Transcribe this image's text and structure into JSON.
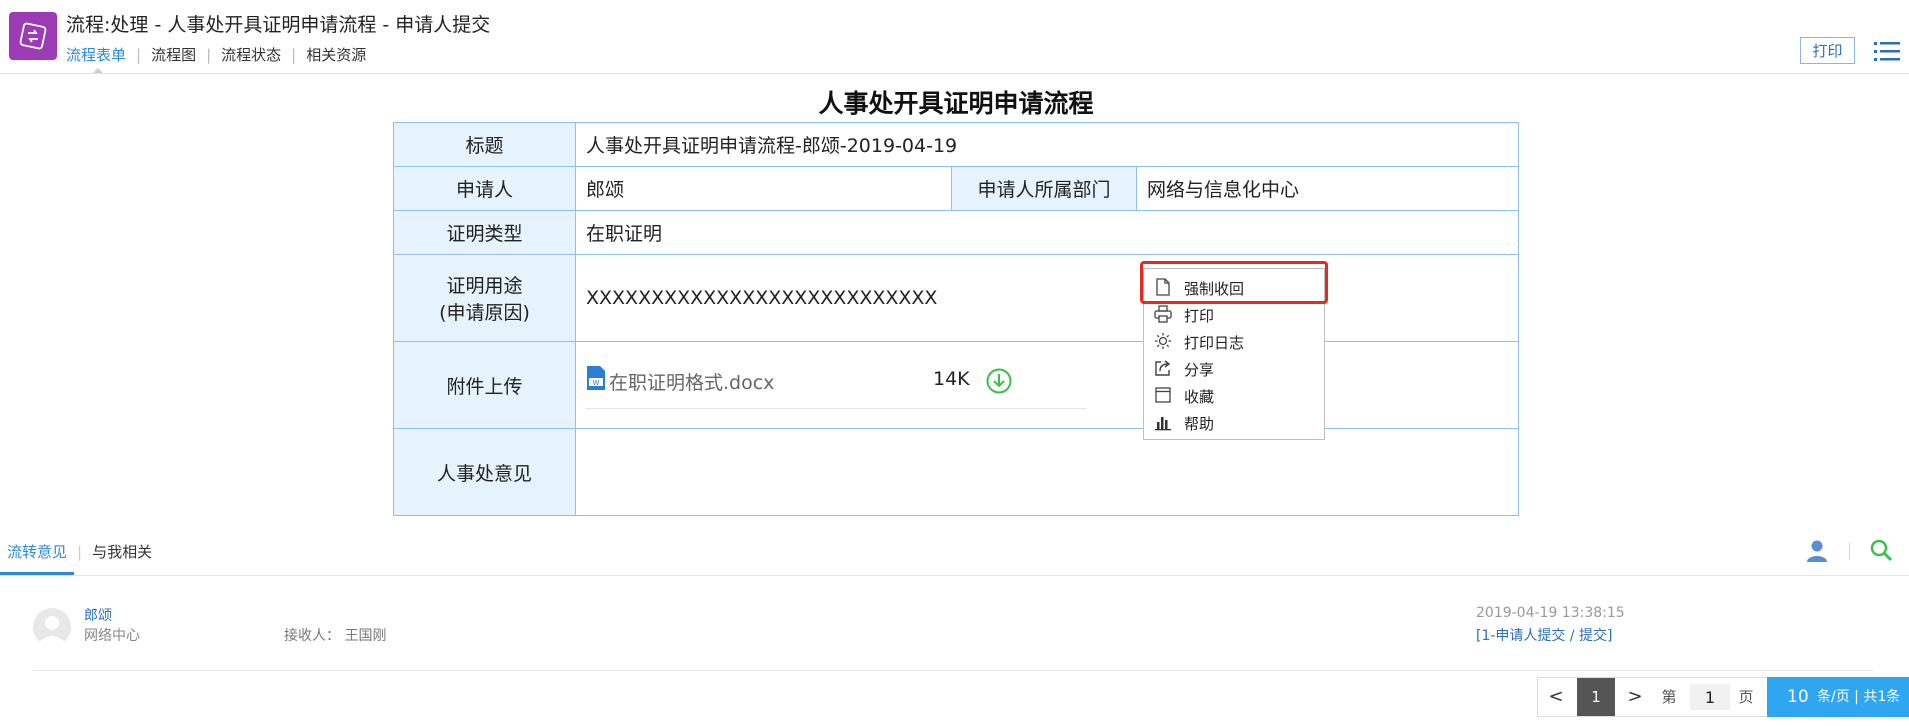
{
  "header": {
    "title": "流程:处理 - 人事处开具证明申请流程 - 申请人提交",
    "tabs": [
      "流程表单",
      "流程图",
      "流程状态",
      "相关资源"
    ],
    "print_label": "打印"
  },
  "form": {
    "title": "人事处开具证明申请流程",
    "title_label": "标题",
    "title_value": "人事处开具证明申请流程-郎颂-2019-04-19",
    "applicant_label": "申请人",
    "applicant_value": "郎颂",
    "dept_label": "申请人所属部门",
    "dept_value": "网络与信息化中心",
    "cert_type_label": "证明类型",
    "cert_type_value": "在职证明",
    "purpose_label_1": "证明用途",
    "purpose_label_2": "(申请原因)",
    "purpose_value": "XXXXXXXXXXXXXXXXXXXXXXXXXXX",
    "attachment_label": "附件上传",
    "attachment_file": "在职证明格式.docx",
    "attachment_size": "14K",
    "opinion_label": "人事处意见"
  },
  "context_menu": {
    "items": [
      "强制收回",
      "打印",
      "打印日志",
      "分享",
      "收藏",
      "帮助"
    ]
  },
  "bottom_tabs": [
    "流转意见",
    "与我相关"
  ],
  "log": {
    "name": "郎颂",
    "dept": "网络中心",
    "receiver_label": "接收人：",
    "receiver": "王国刚",
    "time": "2019-04-19    13:38:15",
    "step": "[1-申请人提交 / 提交]"
  },
  "pager": {
    "prev": "<",
    "current": "1",
    "next": ">",
    "di": "第",
    "page_input": "1",
    "ye": "页",
    "size": "10",
    "size_text": "条/页 | 共1条"
  },
  "colors": {
    "accent": "#2c8ad6",
    "app_icon": "#9b3bb5",
    "highlight": "#e52a20",
    "label_bg": "#e6f2fc",
    "pager_blue": "#2fa7f0"
  }
}
